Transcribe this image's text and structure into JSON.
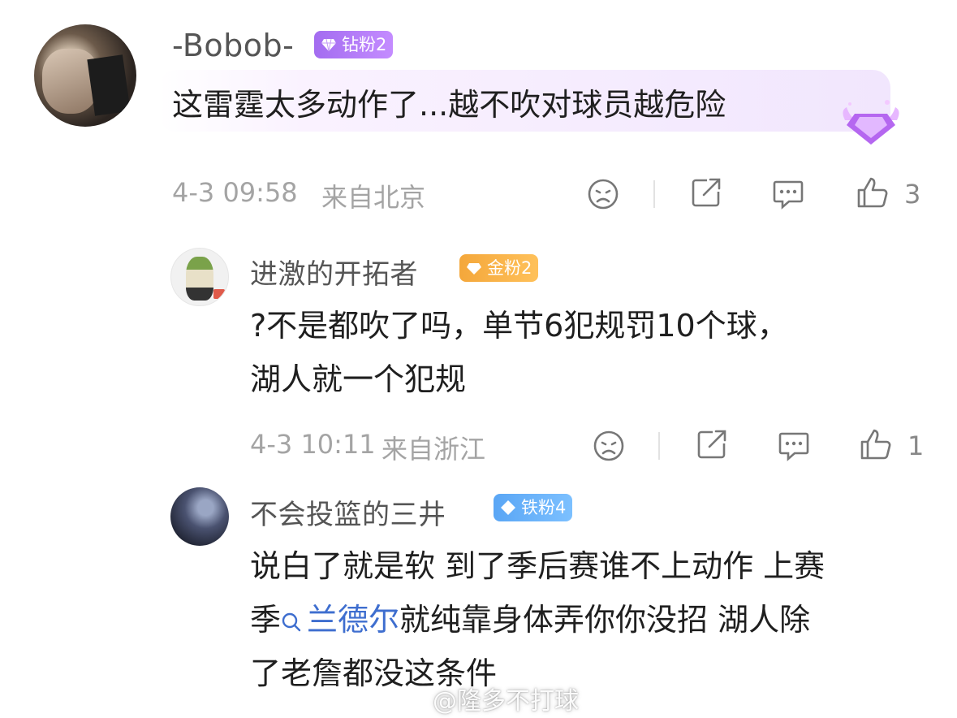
{
  "comments": [
    {
      "username": "-Bobob-",
      "badge": "钻粉2",
      "text_lines": [
        "这雷霆太多动作了...越不吹对球员越危险"
      ],
      "time": "4-3 09:58",
      "location": "来自北京",
      "likes": "3"
    },
    {
      "username": "进激的开拓者",
      "badge": "金粉2",
      "text_lines": [
        "?不是都吹了吗，单节6犯规罚10个球，",
        "湖人就一个犯规"
      ],
      "time": "4-3 10:11",
      "location": "来自浙江",
      "likes": "1"
    },
    {
      "username": "不会投篮的三井",
      "badge": "铁粉4",
      "line1": "说白了就是软 到了季后赛谁不上动作 上赛",
      "line2_pre": "季",
      "mention": "兰德尔",
      "line2_post": "就纯靠身体弄你你没招 湖人除",
      "line3": "了老詹都没这条件"
    }
  ],
  "watermark": "@隆多不打球",
  "colors": {
    "diamond_badge": "#a36cf0",
    "gold_badge": "#f4a73b",
    "iron_badge": "#5aa6f5",
    "mention": "#3e6ecf"
  },
  "icons": [
    "sad-face-icon",
    "share-icon",
    "comment-icon",
    "thumb-up-icon",
    "search-icon",
    "weibo-icon",
    "diamond-icon",
    "crown-gem-icon"
  ]
}
